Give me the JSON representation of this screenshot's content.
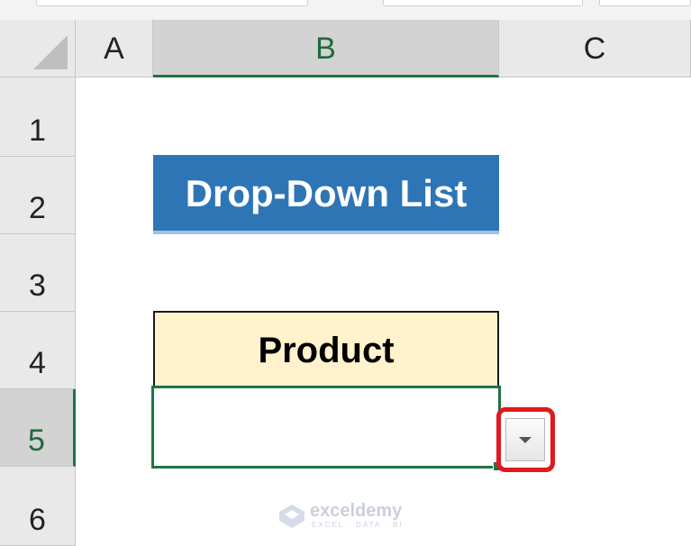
{
  "spreadsheet": {
    "columns": [
      "A",
      "B",
      "C"
    ],
    "rows": [
      "1",
      "2",
      "3",
      "4",
      "5",
      "6"
    ],
    "selected_column": "B",
    "selected_row": "5"
  },
  "cells": {
    "title": "Drop-Down List",
    "header": "Product",
    "active_value": ""
  },
  "colors": {
    "title_fill": "#2e75b6",
    "header_fill": "#fff2cc",
    "selection_green": "#217346",
    "highlight_red": "#e0191e"
  },
  "dropdown": {
    "icon": "chevron-down-icon"
  },
  "watermark": {
    "name": "exceldemy",
    "tagline": "EXCEL · DATA · BI"
  }
}
